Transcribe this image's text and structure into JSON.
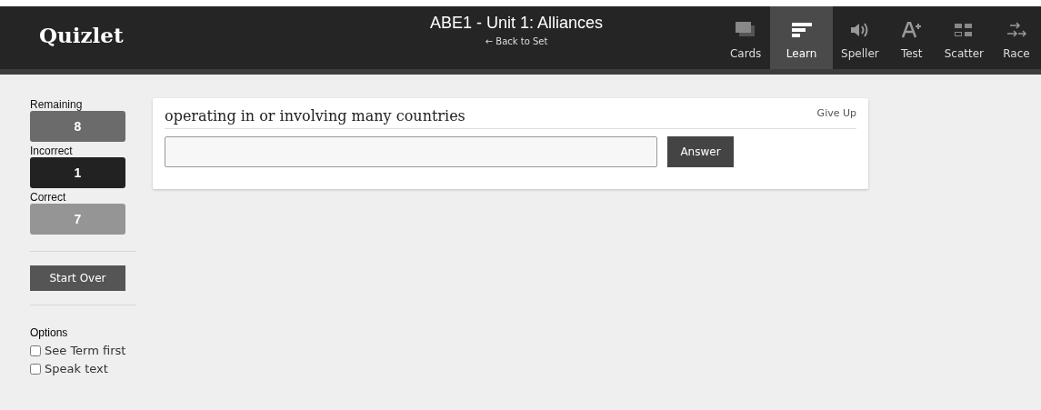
{
  "header": {
    "logo": "Quizlet",
    "title": "ABE1 - Unit 1: Alliances",
    "back_link": "← Back to Set",
    "modes": [
      {
        "kind": "cards",
        "label": "Cards",
        "selected": false
      },
      {
        "kind": "learn",
        "label": "Learn",
        "selected": true
      },
      {
        "kind": "speller",
        "label": "Speller",
        "selected": false
      },
      {
        "kind": "test",
        "label": "Test",
        "selected": false
      },
      {
        "kind": "scatter",
        "label": "Scatter",
        "selected": false
      },
      {
        "kind": "race",
        "label": "Race",
        "selected": false
      }
    ]
  },
  "sidebar": {
    "counters": [
      {
        "label": "Remaining",
        "value": "8",
        "color": "#6b6b6b"
      },
      {
        "label": "Incorrect",
        "value": "1",
        "color": "#222222"
      },
      {
        "label": "Correct",
        "value": "7",
        "color": "#959595"
      }
    ],
    "start_over": "Start Over",
    "options_title": "Options",
    "options": [
      {
        "label": "See Term first",
        "checked": false
      },
      {
        "label": "Speak text",
        "checked": false
      }
    ]
  },
  "question": {
    "prompt": "operating in or involving many countries",
    "give_up": "Give Up",
    "answer_button": "Answer"
  }
}
